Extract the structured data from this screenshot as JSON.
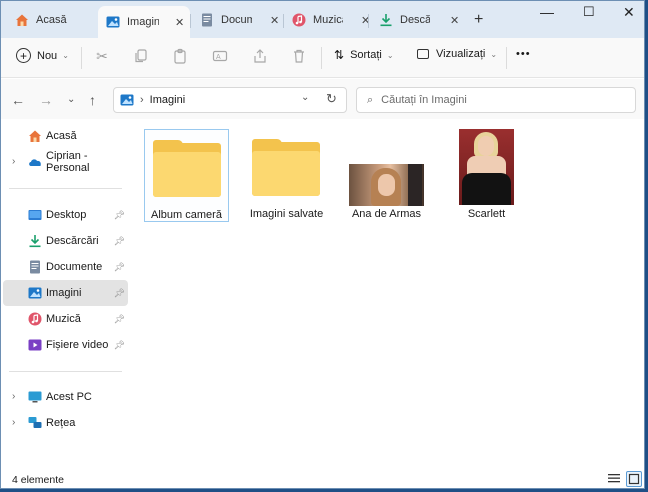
{
  "tabs": [
    {
      "label": "Acasă",
      "icon": "home-icon"
    },
    {
      "label": "Imagini",
      "icon": "pictures-icon",
      "active": true
    },
    {
      "label": "Documente",
      "icon": "documents-icon"
    },
    {
      "label": "Muzică",
      "icon": "music-icon"
    },
    {
      "label": "Descărcări",
      "icon": "downloads-icon"
    }
  ],
  "window_controls": {
    "minimize": "—",
    "maximize": "☐",
    "close": "✕"
  },
  "toolbar": {
    "new_label": "Nou",
    "sort_label": "Sortați",
    "view_label": "Vizualizați",
    "more_label": "•••"
  },
  "address": {
    "folder": "Imagini"
  },
  "search": {
    "placeholder": "Căutați în Imagini"
  },
  "sidebar": {
    "items": [
      {
        "label": "Acasă",
        "icon": "home-icon"
      },
      {
        "label": "Ciprian - Personal",
        "icon": "onedrive-cloud-icon"
      },
      {
        "label": "Desktop",
        "icon": "desktop-icon"
      },
      {
        "label": "Descărcări",
        "icon": "downloads-icon"
      },
      {
        "label": "Documente",
        "icon": "documents-icon"
      },
      {
        "label": "Imagini",
        "icon": "pictures-icon",
        "selected": true
      },
      {
        "label": "Muzică",
        "icon": "music-icon"
      },
      {
        "label": "Fișiere video",
        "icon": "videos-icon"
      },
      {
        "label": "Acest PC",
        "icon": "pc-icon"
      },
      {
        "label": "Rețea",
        "icon": "network-icon"
      }
    ]
  },
  "content": {
    "items": [
      {
        "label": "Album cameră",
        "type": "folder"
      },
      {
        "label": "Imagini salvate",
        "type": "folder"
      },
      {
        "label": "Ana de Armas",
        "type": "image"
      },
      {
        "label": "Scarlett",
        "type": "image"
      }
    ]
  },
  "status": {
    "count_text": "4 elemente"
  },
  "colors": {
    "folder": "#f3c34d",
    "selection": "#e3e3e3",
    "accent": "#0067c0",
    "tabbar": "#dfe9f4"
  }
}
